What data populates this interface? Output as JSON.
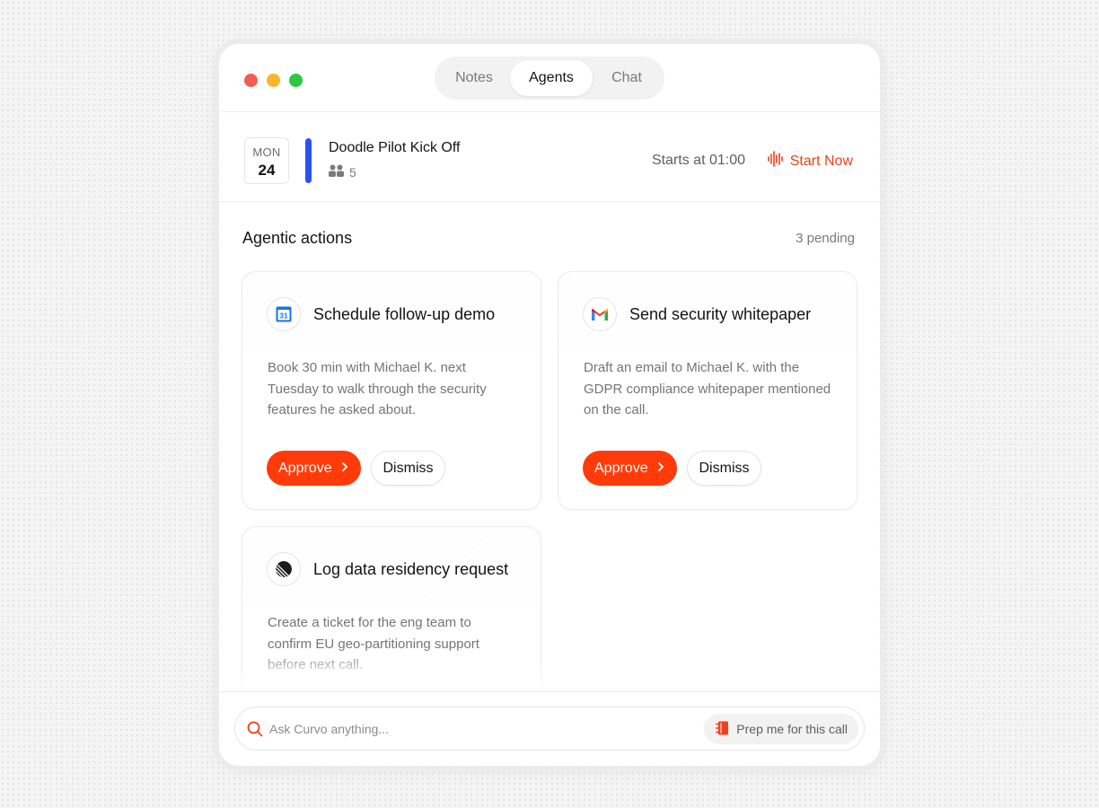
{
  "window": {
    "tabs": [
      {
        "label": "Notes",
        "active": false
      },
      {
        "label": "Agents",
        "active": true
      },
      {
        "label": "Chat",
        "active": false
      }
    ]
  },
  "meeting": {
    "day_of_week": "MON",
    "day": "24",
    "title": "Doodle Pilot Kick Off",
    "attendee_count": "5",
    "starts_text": "Starts at 01:00",
    "start_now_label": "Start Now",
    "accent_color": "#2a52f0"
  },
  "actions": {
    "section_title": "Agentic actions",
    "pending_text": "3 pending",
    "cards": [
      {
        "icon": "google-calendar-icon",
        "icon_text": "31",
        "title": "Schedule follow-up demo",
        "description": "Book 30 min with Michael K. next Tuesday to walk through the security features he asked about.",
        "approve_label": "Approve",
        "dismiss_label": "Dismiss"
      },
      {
        "icon": "gmail-icon",
        "title": "Send security whitepaper",
        "description": "Draft an email to Michael K. with the GDPR compliance whitepaper mentioned on the call.",
        "approve_label": "Approve",
        "dismiss_label": "Dismiss"
      },
      {
        "icon": "linear-icon",
        "title": "Log data residency request",
        "description": "Create a ticket for the eng team to confirm EU geo-partitioning support before next call."
      }
    ]
  },
  "footer": {
    "ask_placeholder": "Ask Curvo anything...",
    "prep_label": "Prep me for this call"
  },
  "colors": {
    "brand_orange": "#ff3b0a",
    "start_now": "#f0401a"
  }
}
